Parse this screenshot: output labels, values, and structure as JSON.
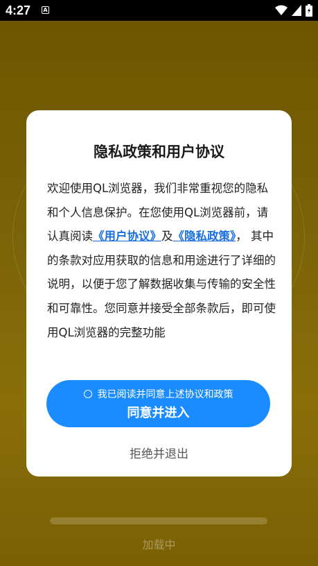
{
  "status_bar": {
    "time": "4:27",
    "icons": [
      "a-badge-icon",
      "wifi-icon",
      "signal-icon",
      "battery-icon"
    ]
  },
  "background": {
    "title_text": "",
    "loading_text": "加载中"
  },
  "dialog": {
    "title": "隐私政策和用户协议",
    "body": {
      "intro": "欢迎使用QL浏览器，我们非常重视您的隐私和个人信息保护。在您使用QL浏览器前，请认真阅读",
      "link_user_agreement": "《用户协议》",
      "and": "及",
      "link_privacy_policy": "《隐私政策》",
      "rest": "， 其中的条款对应用获取的信息和用途进行了详细的说明，以便于您了解数据收集与传输的安全性和可靠性。您同意并接受全部条款后，即可使用QL浏览器的完整功能"
    },
    "checkbox_label": "我已阅读并同意上述协议和政策",
    "agree_button": "同意并进入",
    "reject_button": "拒绝并退出"
  },
  "colors": {
    "accent": "#1a8cff",
    "link": "#1a6fe0",
    "backdrop": "#7a6308"
  }
}
